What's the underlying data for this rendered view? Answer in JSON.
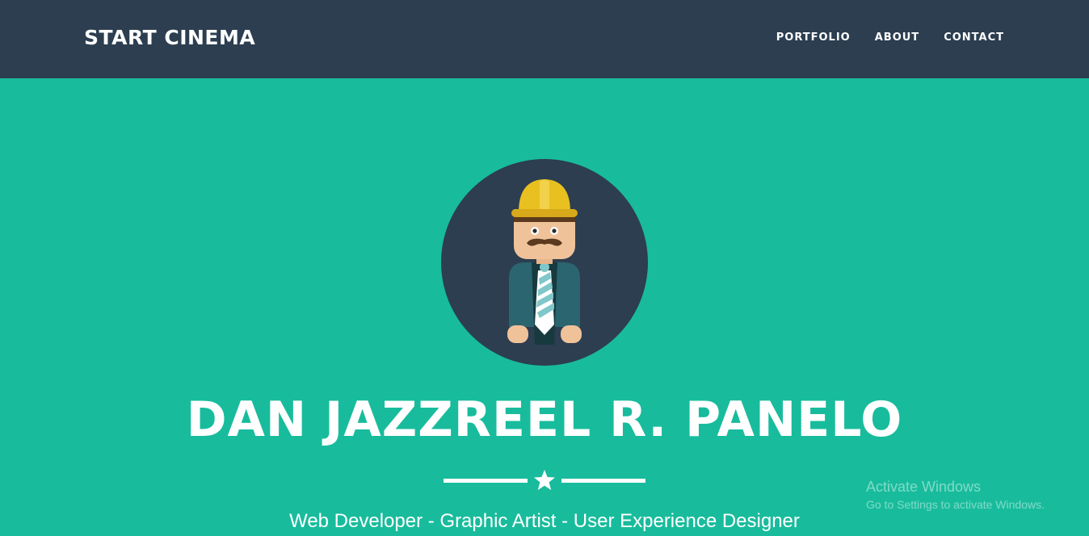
{
  "navbar": {
    "brand": "START CINEMA",
    "links": [
      "PORTFOLIO",
      "ABOUT",
      "CONTACT"
    ],
    "background": "#2c3e50"
  },
  "hero": {
    "background": "#18bc9c",
    "avatar_icon": "construction-worker-avatar-icon",
    "name": "DAN JAZZREEL R. PANELO",
    "divider_icon": "star-icon",
    "tagline": "Web Developer - Graphic Artist - User Experience Designer"
  },
  "watermark": {
    "title": "Activate Windows",
    "subtitle": "Go to Settings to activate Windows."
  }
}
